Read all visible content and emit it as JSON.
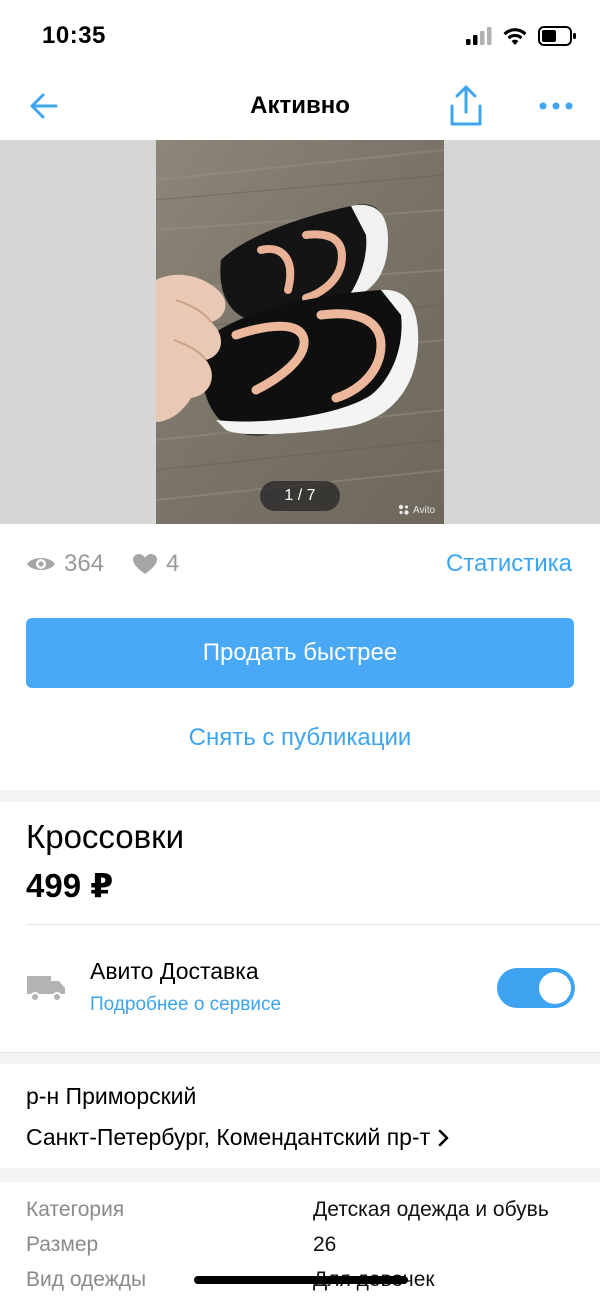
{
  "status_bar": {
    "time": "10:35"
  },
  "nav": {
    "title": "Активно"
  },
  "gallery": {
    "counter": "1 / 7",
    "watermark": "Avito"
  },
  "stats": {
    "views": "364",
    "likes": "4",
    "stats_link": "Статистика"
  },
  "actions": {
    "sell_faster": "Продать быстрее",
    "unpublish": "Снять с публикации"
  },
  "item": {
    "title": "Кроссовки",
    "price": "499 ₽"
  },
  "delivery": {
    "title": "Авито Доставка",
    "link": "Подробнее о сервисе",
    "enabled": true
  },
  "location": {
    "district": "р-н Приморский",
    "address": "Санкт-Петербург, Комендантский пр-т"
  },
  "params": [
    {
      "label": "Категория",
      "value": "Детская одежда и обувь"
    },
    {
      "label": "Размер",
      "value": "26"
    },
    {
      "label": "Вид одежды",
      "value": "Для девочек"
    }
  ],
  "colors": {
    "accent": "#4aa9f7",
    "link": "#3ea4f2",
    "muted": "#999999"
  },
  "icons": [
    "back-arrow-icon",
    "share-icon",
    "more-icon",
    "eye-icon",
    "heart-icon",
    "truck-icon",
    "chevron-right-icon"
  ]
}
